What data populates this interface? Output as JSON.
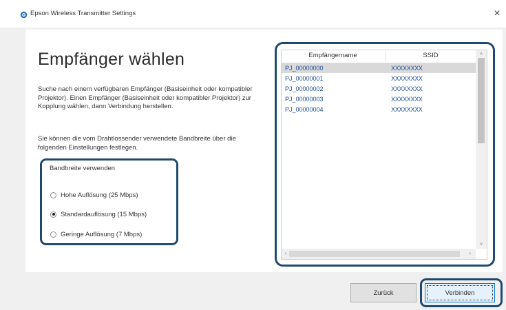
{
  "window": {
    "title": "Epson Wireless Transmitter Settings",
    "close_glyph": "×"
  },
  "main": {
    "heading": "Empfänger wählen",
    "paragraph1": "Suche nach einem verfügbaren Empfänger (Basiseinheit oder kompatibler Projektor). Einen Empfänger (Basiseinheit oder kompatibler Projektor) zur Kopplung wählen, dann Verbindung herstellen.",
    "paragraph2": "Sie können die vom Drahtlossender verwendete Bandbreite über die folgenden Einstellungen festlegen."
  },
  "bandwidth": {
    "title": "Bandbreite verwenden",
    "options": [
      {
        "label": "Hohe Auflösung (25 Mbps)",
        "checked": false
      },
      {
        "label": "Standardauflösung (15 Mbps)",
        "checked": true
      },
      {
        "label": "Geringe Auflösung (7 Mbps)",
        "checked": false
      }
    ]
  },
  "receiver_list": {
    "columns": [
      "Empfängername",
      "SSID"
    ],
    "rows": [
      {
        "name": "PJ_00000000",
        "ssid": "XXXXXXXX",
        "selected": true
      },
      {
        "name": "PJ_00000001",
        "ssid": "XXXXXXXX",
        "selected": false
      },
      {
        "name": "PJ_00000002",
        "ssid": "XXXXXXXX",
        "selected": false
      },
      {
        "name": "PJ_00000003",
        "ssid": "XXXXXXXX",
        "selected": false
      },
      {
        "name": "PJ_00000004",
        "ssid": "XXXXXXXX",
        "selected": false
      }
    ]
  },
  "footer": {
    "back_label": "Zurück",
    "connect_label": "Verbinden"
  },
  "icons": {
    "app": "epson-app-icon",
    "scroll_up": "scroll-up-arrow-icon",
    "scroll_down": "scroll-down-arrow-icon",
    "scroll_left": "scroll-left-arrow-icon",
    "scroll_right": "scroll-right-arrow-icon"
  },
  "colors": {
    "highlight_frame": "#1f4a6e",
    "list_text": "#1e4f9a",
    "selected_row": "#d9d9d9"
  }
}
